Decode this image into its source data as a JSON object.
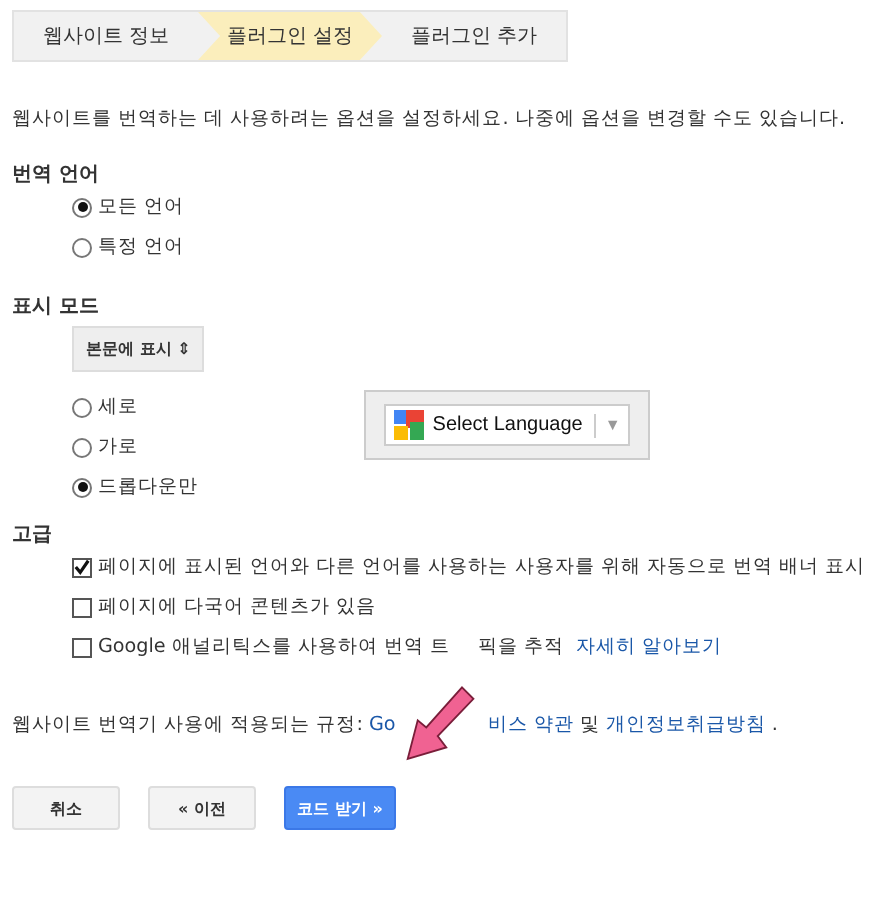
{
  "steps": [
    {
      "label": "웹사이트 정보",
      "selected": false
    },
    {
      "label": "플러그인 설정",
      "selected": true
    },
    {
      "label": "플러그인 추가",
      "selected": false
    }
  ],
  "intro": "웹사이트를 번역하는 데 사용하려는 옵션을 설정하세요. 나중에 옵션을 변경할 수도 있습니다.",
  "language_section": {
    "heading": "번역 언어",
    "options": [
      {
        "label": "모든 언어",
        "selected": true
      },
      {
        "label": "특정 언어",
        "selected": false
      }
    ]
  },
  "display_section": {
    "heading": "표시 모드",
    "select": {
      "value": "본문에 표시",
      "arrow": "⇕"
    },
    "options": [
      {
        "label": "세로",
        "selected": false
      },
      {
        "label": "가로",
        "selected": false
      },
      {
        "label": "드롭다운만",
        "selected": true
      }
    ],
    "preview": {
      "label": "Select Language",
      "arrow": "▼"
    }
  },
  "advanced_section": {
    "heading": "고급",
    "options": [
      {
        "label": "페이지에 표시된 언어와 다른 언어를 사용하는 사용자를 위해 자동으로 번역 배너 표시",
        "checked": true
      },
      {
        "label": "페이지에 다국어 콘텐츠가 있음",
        "checked": false
      },
      {
        "label": "Google 애널리틱스를 사용하여 번역 트",
        "label_after": "픽을 추적",
        "link": "자세히 알아보기",
        "checked": false
      }
    ]
  },
  "policy": {
    "text": "웹사이트 번역기 사용에 적용되는 규정:",
    "link_1_start": "Go",
    "link_1_end": "비스 약관",
    "joiner": "및",
    "link_2": "개인정보취급방침",
    "end": "."
  },
  "buttons": [
    {
      "label": "취소",
      "kind": "secondary"
    },
    {
      "label": "« 이전",
      "kind": "secondary"
    },
    {
      "label": "코드 받기 »",
      "kind": "primary"
    }
  ]
}
